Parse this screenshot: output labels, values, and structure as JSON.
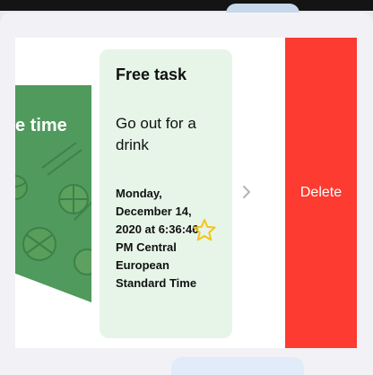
{
  "image_card": {
    "title": "e time",
    "image": "sports-balls-illustration"
  },
  "task": {
    "kind": "Free task",
    "title": "Go out for a drink",
    "date": "Monday, December 14, 2020 at 6:36:46 PM Central European Standard Time"
  },
  "icons": {
    "star": "star-outline-icon",
    "chevron": "chevron-right-icon"
  },
  "actions": {
    "delete_label": "Delete"
  },
  "colors": {
    "delete": "#fd3b30",
    "task_card_bg": "#e6f5e8",
    "image_card_bg": "#4f9a5c",
    "star": "#f5c518"
  }
}
